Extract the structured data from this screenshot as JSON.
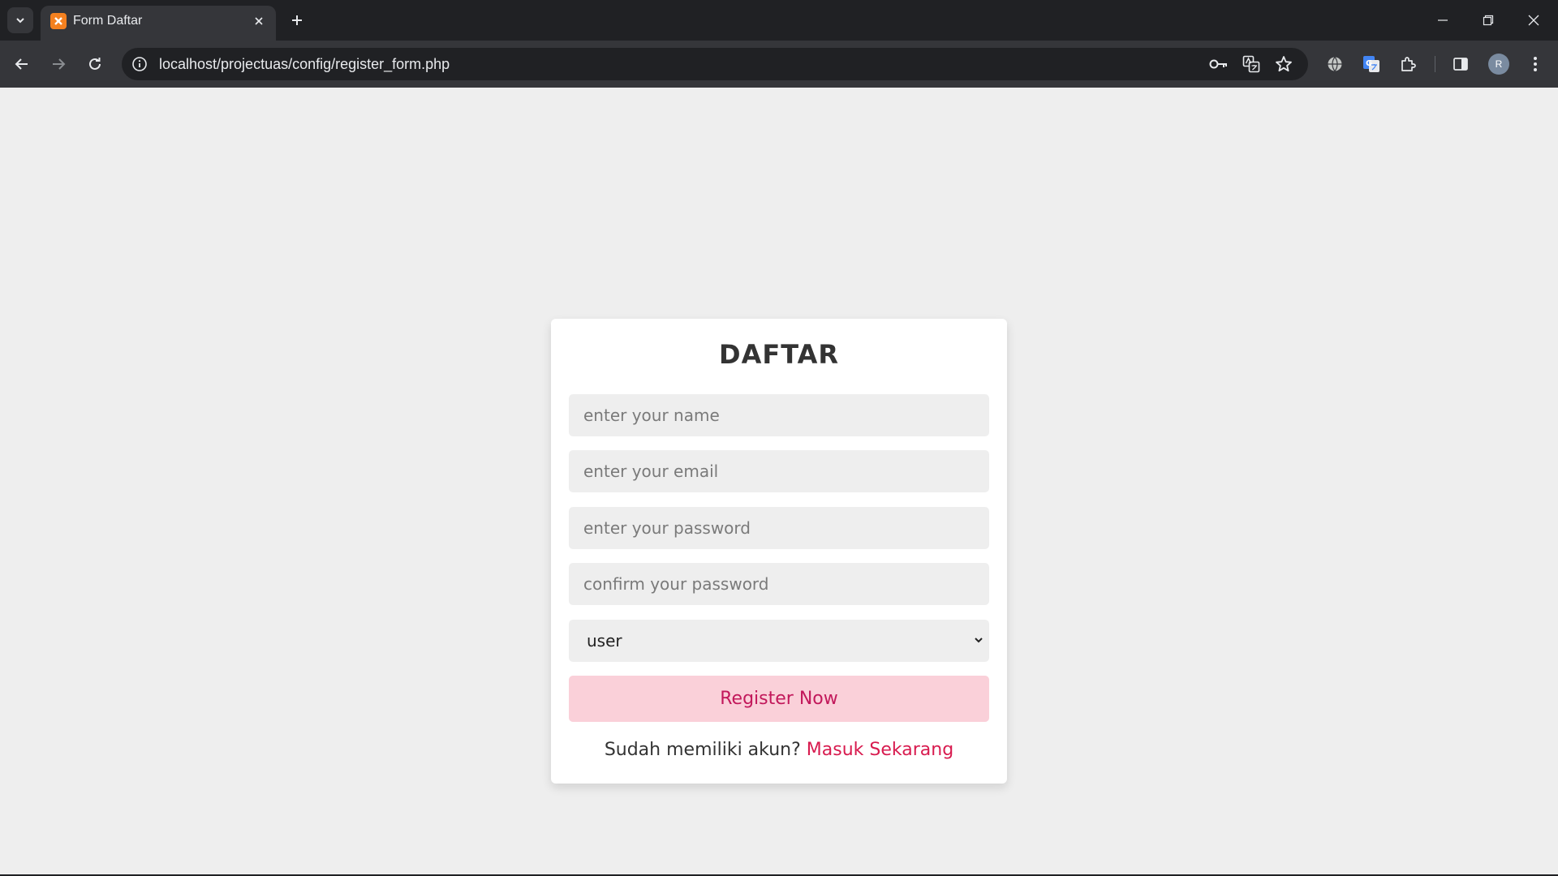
{
  "browser": {
    "tab": {
      "title": "Form Daftar"
    },
    "address": {
      "url": "localhost/projectuas/config/register_form.php"
    },
    "profile_initial": "R"
  },
  "page": {
    "title": "DAFTAR",
    "fields": {
      "name_placeholder": "enter your name",
      "email_placeholder": "enter your email",
      "password_placeholder": "enter your password",
      "confirm_placeholder": "confirm your password"
    },
    "role_select": {
      "selected": "user"
    },
    "submit_label": "Register Now",
    "footer": {
      "prompt": "Sudah memiliki akun?",
      "link_label": "Masuk Sekarang"
    }
  },
  "colors": {
    "accent": "#d81b4f",
    "button_bg": "#fad0d9",
    "page_bg": "#eeeeee"
  }
}
